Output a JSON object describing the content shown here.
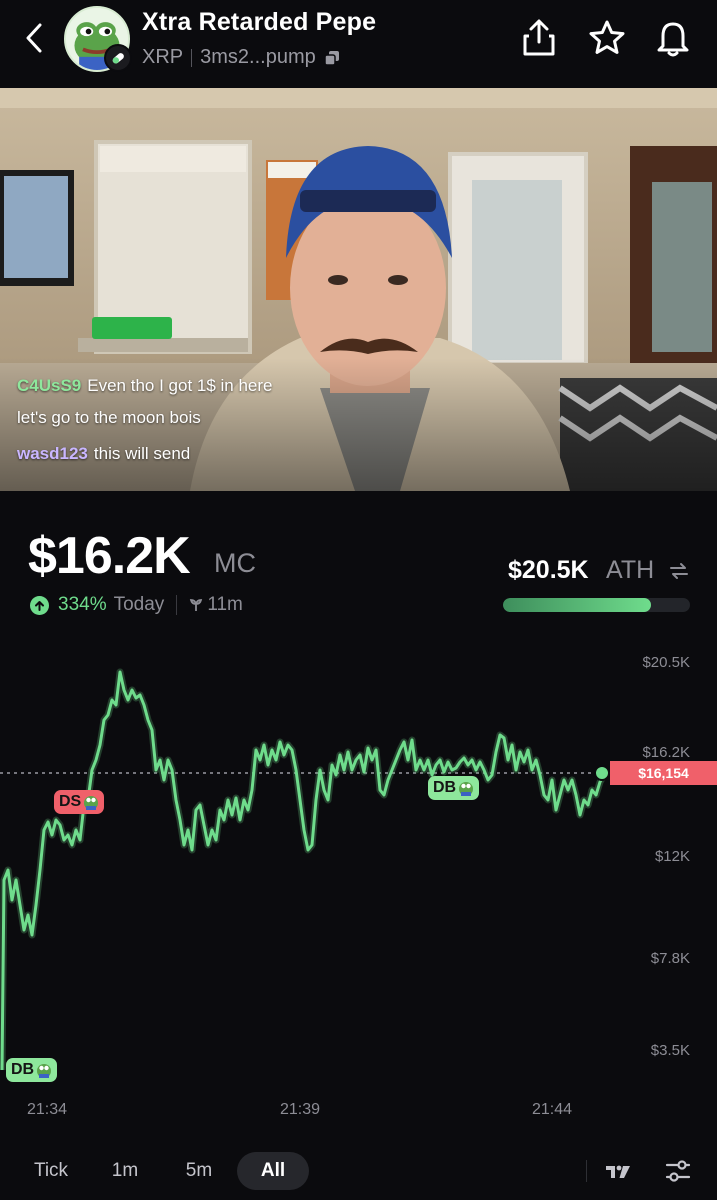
{
  "header": {
    "title": "Xtra Retarded Pepe",
    "chain": "XRP",
    "address": "3ms2...pump"
  },
  "video": {
    "chat": [
      {
        "user": "C4UsS9",
        "text": "Even tho I got 1$ in here"
      },
      {
        "user": "",
        "text": "let's go to the moon bois"
      },
      {
        "user": "wasd123",
        "text": "this will send"
      }
    ]
  },
  "stats": {
    "market_cap": "$16.2K",
    "market_cap_label": "MC",
    "change_pct": "334%",
    "change_period": "Today",
    "age": "11m",
    "ath_value": "$20.5K",
    "ath_label": "ATH",
    "ath_progress": 0.79
  },
  "chart_data": {
    "type": "line",
    "y_axis_labels": [
      "$20.5K",
      "$16.2K",
      "$12K",
      "$7.8K",
      "$3.5K"
    ],
    "x_axis_labels": [
      "21:34",
      "21:39",
      "21:44"
    ],
    "current_price_label": "$16,154",
    "current_price": 16154,
    "ylim": [
      3500,
      20500
    ],
    "line_color": "#6fdc8c",
    "markers": [
      {
        "label": "DS",
        "color": "red"
      },
      {
        "label": "DB",
        "color": "green"
      },
      {
        "label": "DB",
        "color": "green"
      }
    ]
  },
  "timeframes": [
    {
      "label": "Tick",
      "active": false
    },
    {
      "label": "1m",
      "active": false
    },
    {
      "label": "5m",
      "active": false
    },
    {
      "label": "All",
      "active": true
    }
  ]
}
